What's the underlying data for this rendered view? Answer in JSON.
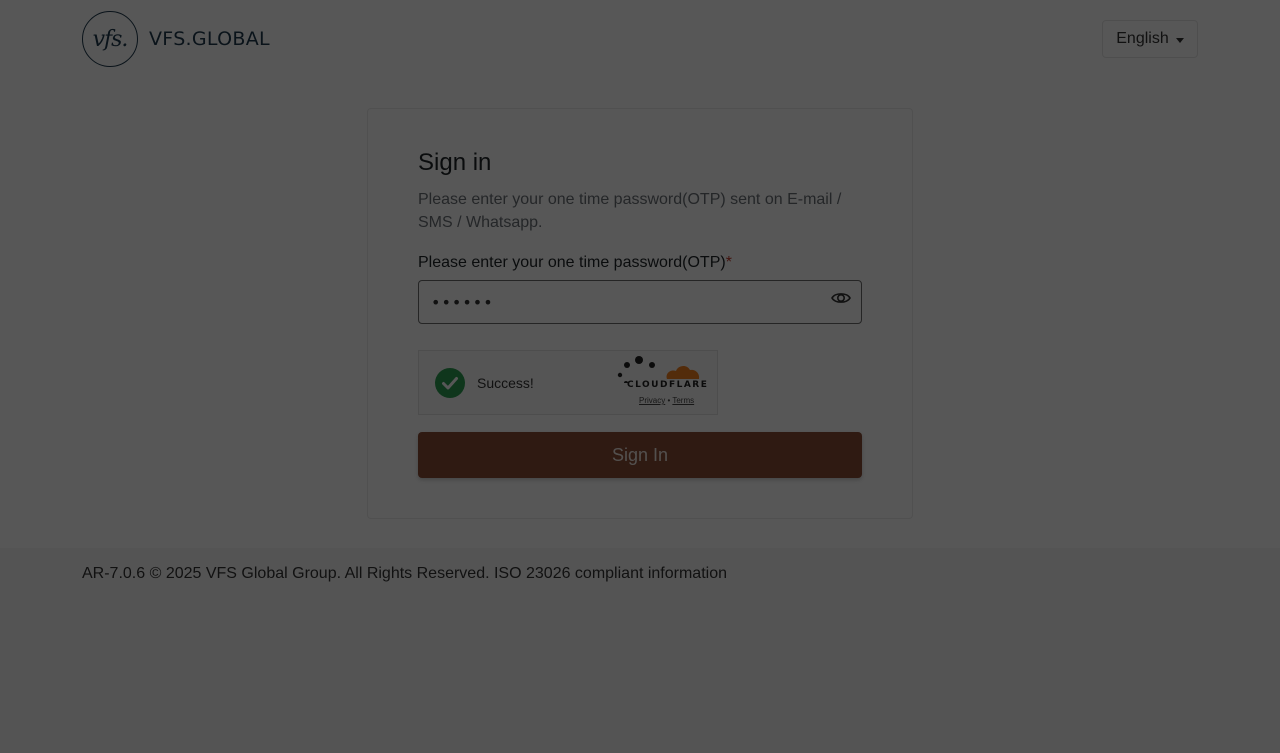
{
  "header": {
    "logo_mark": "vfs.",
    "logo_text": "VFS.GLOBAL",
    "language_label": "English"
  },
  "signin": {
    "title": "Sign in",
    "subtitle": "Please enter your one time password(OTP) sent on E-mail / SMS / Whatsapp.",
    "otp_label": "Please enter your one time password(OTP)",
    "required_marker": "*",
    "otp_value": "••••••",
    "button_label": "Sign In"
  },
  "captcha": {
    "status_text": "Success!",
    "provider": "CLOUDFLARE",
    "privacy_link": "Privacy",
    "separator": "•",
    "terms_link": "Terms"
  },
  "footer": {
    "text": "AR-7.0.6 © 2025 VFS Global Group. All Rights Reserved. ISO 23026 compliant information"
  },
  "colors": {
    "brand_dark": "#1f3a4d",
    "signin_button": "#8b4c36",
    "success_green": "#2e9e52",
    "cloudflare_orange": "#f38020",
    "overlay": "rgba(0,0,0,0.66)"
  },
  "icons": {
    "password_toggle": "eye-icon",
    "captcha_status": "check-circle-icon",
    "language_dropdown": "chevron-down-icon"
  }
}
